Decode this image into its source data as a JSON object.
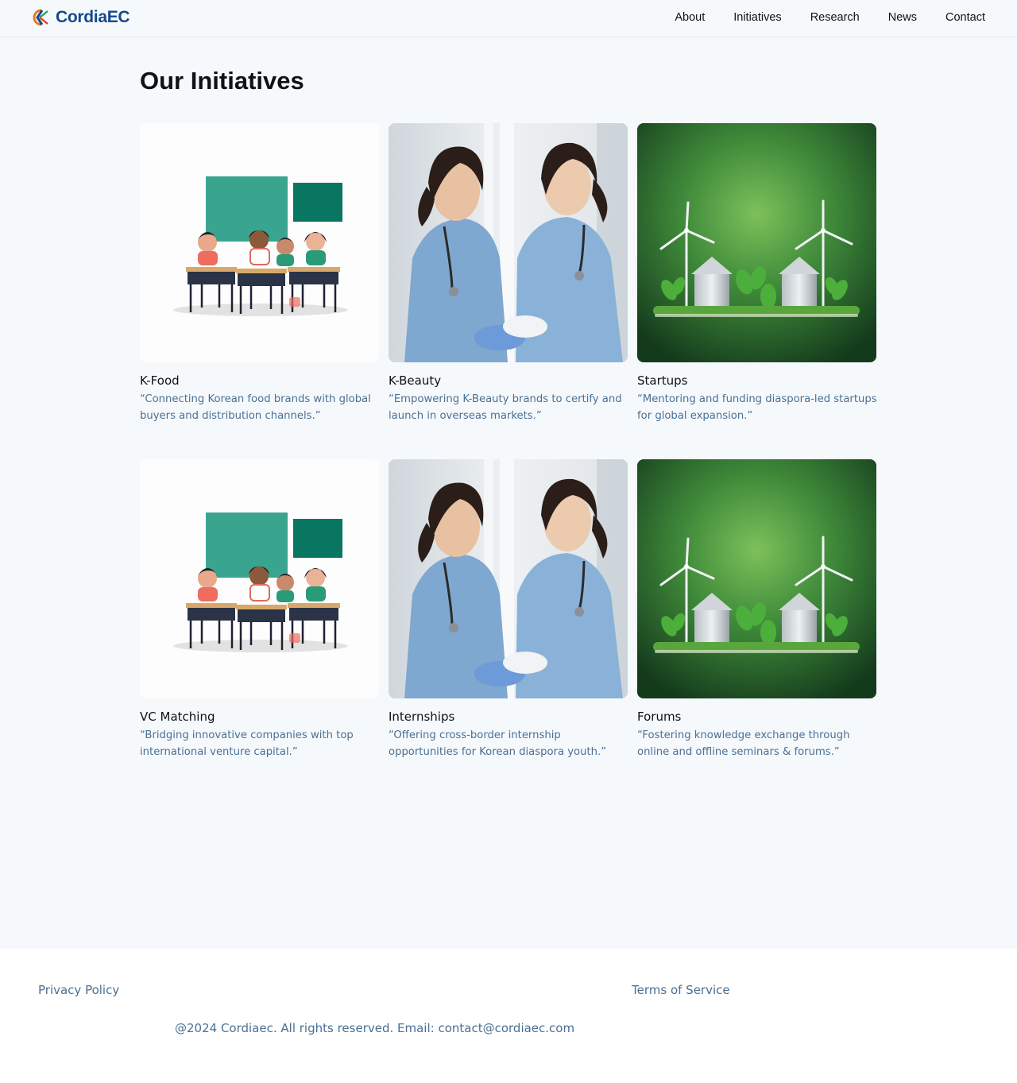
{
  "brand": {
    "name": "CordiaEC"
  },
  "nav": {
    "items": [
      {
        "label": "About"
      },
      {
        "label": "Initiatives"
      },
      {
        "label": "Research"
      },
      {
        "label": "News"
      },
      {
        "label": "Contact"
      }
    ]
  },
  "main": {
    "title": "Our Initiatives",
    "cards": [
      {
        "title": "K-Food",
        "description": "“Connecting Korean food brands with global buyers and distribution channels.”",
        "image": "classroom-illustration"
      },
      {
        "title": "K-Beauty",
        "description": "“Empowering K-Beauty brands to certify and launch in overseas markets.”",
        "image": "nurses-photo"
      },
      {
        "title": "Startups",
        "description": "“Mentoring and funding diaspora-led startups for global expansion.”",
        "image": "wind-turbines-illustration"
      },
      {
        "title": "VC Matching",
        "description": "“Bridging innovative companies with top international venture capital.”",
        "image": "classroom-illustration"
      },
      {
        "title": "Internships",
        "description": "“Offering cross-border internship opportunities for Korean diaspora youth.”",
        "image": "nurses-photo"
      },
      {
        "title": "Forums",
        "description": "“Fostering knowledge exchange through online and offline seminars & forums.”",
        "image": "wind-turbines-illustration"
      }
    ]
  },
  "footer": {
    "privacy": "Privacy Policy",
    "terms": "Terms of Service",
    "copyright": "@2024 Cordiaec. All rights reserved. Email: contact@cordiaec.com"
  }
}
